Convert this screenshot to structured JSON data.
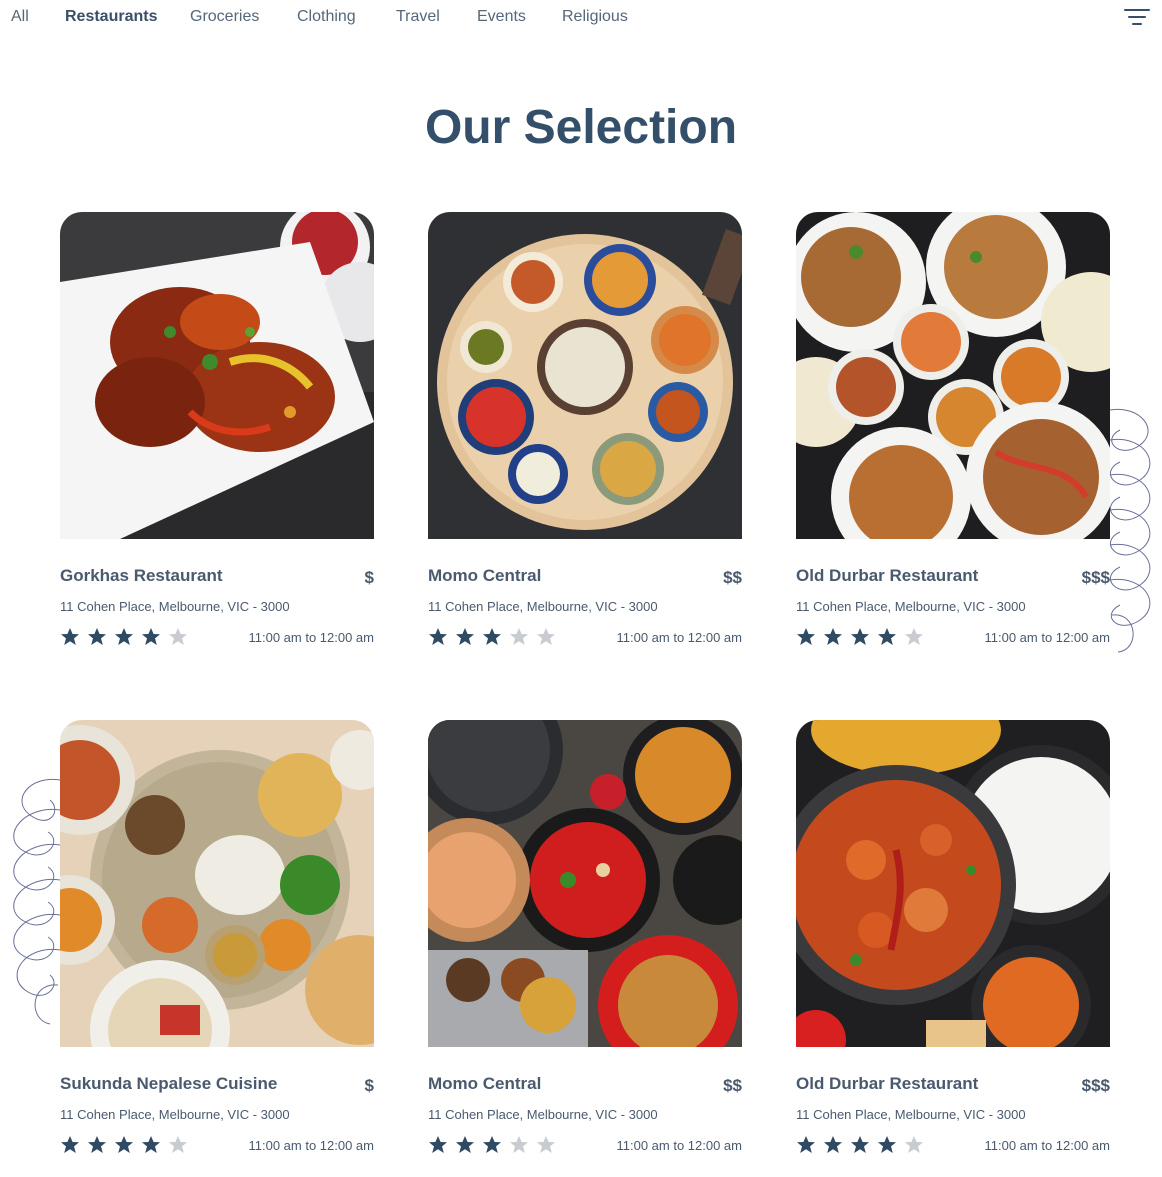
{
  "tabs": [
    {
      "label": "All"
    },
    {
      "label": "Restaurants",
      "active": true
    },
    {
      "label": "Groceries"
    },
    {
      "label": "Clothing"
    },
    {
      "label": "Travel"
    },
    {
      "label": "Events"
    },
    {
      "label": "Religious"
    }
  ],
  "filter_icon": "filter-lines-icon",
  "page_title": "Our Selection",
  "colors": {
    "accent": "#344f69",
    "star_on": "#2f4a63",
    "star_off": "#c8ccd1",
    "swirl": "#6b6f9a"
  },
  "restaurants": [
    {
      "name": "Gorkhas Restaurant",
      "price": "$",
      "address": "11 Cohen Place, Melbourne, VIC - 3000",
      "rating": 4,
      "max_rating": 5,
      "hours": "11:00 am to 12:00 am",
      "image": "chilli-paneer-plate"
    },
    {
      "name": "Momo Central",
      "price": "$$",
      "address": "11 Cohen Place, Melbourne, VIC - 3000",
      "rating": 3,
      "max_rating": 5,
      "hours": "11:00 am to 12:00 am",
      "image": "thali-platter"
    },
    {
      "name": "Old Durbar Restaurant",
      "price": "$$$",
      "address": "11 Cohen Place, Melbourne, VIC - 3000",
      "rating": 4,
      "max_rating": 5,
      "hours": "11:00 am to 12:00 am",
      "image": "curry-spread"
    },
    {
      "name": "Sukunda Nepalese Cuisine",
      "price": "$",
      "address": "11 Cohen Place, Melbourne, VIC - 3000",
      "rating": 4,
      "max_rating": 5,
      "hours": "11:00 am to 12:00 am",
      "image": "nepali-thali"
    },
    {
      "name": "Momo Central",
      "price": "$$",
      "address": "11 Cohen Place, Melbourne, VIC - 3000",
      "rating": 3,
      "max_rating": 5,
      "hours": "11:00 am to 12:00 am",
      "image": "momo-soup-spread"
    },
    {
      "name": "Old Durbar Restaurant",
      "price": "$$$",
      "address": "11 Cohen Place, Melbourne, VIC - 3000",
      "rating": 4,
      "max_rating": 5,
      "hours": "11:00 am to 12:00 am",
      "image": "chicken-curry-rice"
    }
  ]
}
